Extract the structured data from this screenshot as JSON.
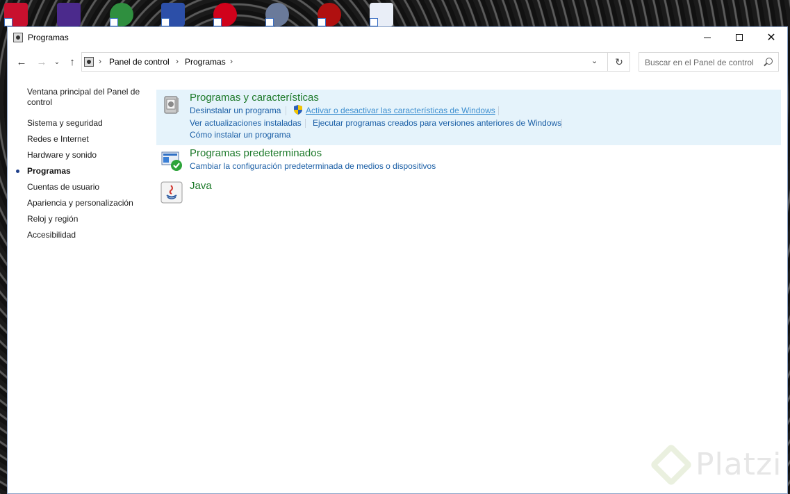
{
  "window": {
    "title": "Programas"
  },
  "navigation": {
    "back_icon": "←",
    "forward_icon": "→",
    "recent_icon": "⌄",
    "up_icon": "↑",
    "breadcrumb": [
      "Panel de control",
      "Programas"
    ],
    "separator": "›",
    "dropdown_icon": "⌄",
    "refresh_icon": "↻"
  },
  "search": {
    "placeholder": "Buscar en el Panel de control"
  },
  "sidebar": {
    "items": [
      {
        "label": "Ventana principal del Panel de control"
      },
      {
        "label": "Sistema y seguridad"
      },
      {
        "label": "Redes e Internet"
      },
      {
        "label": "Hardware y sonido"
      },
      {
        "label": "Programas",
        "active": true
      },
      {
        "label": "Cuentas de usuario"
      },
      {
        "label": "Apariencia y personalización"
      },
      {
        "label": "Reloj y región"
      },
      {
        "label": "Accesibilidad"
      }
    ]
  },
  "sections": [
    {
      "title": "Programas y características",
      "icon": "programs-features-icon",
      "links": [
        "Desinstalar un programa",
        "Activar o desactivar las características de Windows",
        "Ver actualizaciones instaladas",
        "Ejecutar programas creados para versiones anteriores de Windows",
        "Cómo instalar un programa"
      ]
    },
    {
      "title": "Programas predeterminados",
      "icon": "default-programs-icon",
      "links": [
        "Cambiar la configuración predeterminada de medios o dispositivos"
      ]
    },
    {
      "title": "Java",
      "icon": "java-icon",
      "links": []
    }
  ],
  "watermark": {
    "text": "Platzi"
  },
  "colors": {
    "section_title": "#1e7a2b",
    "link": "#1b5fa6",
    "highlight": "#e5f3fb"
  }
}
